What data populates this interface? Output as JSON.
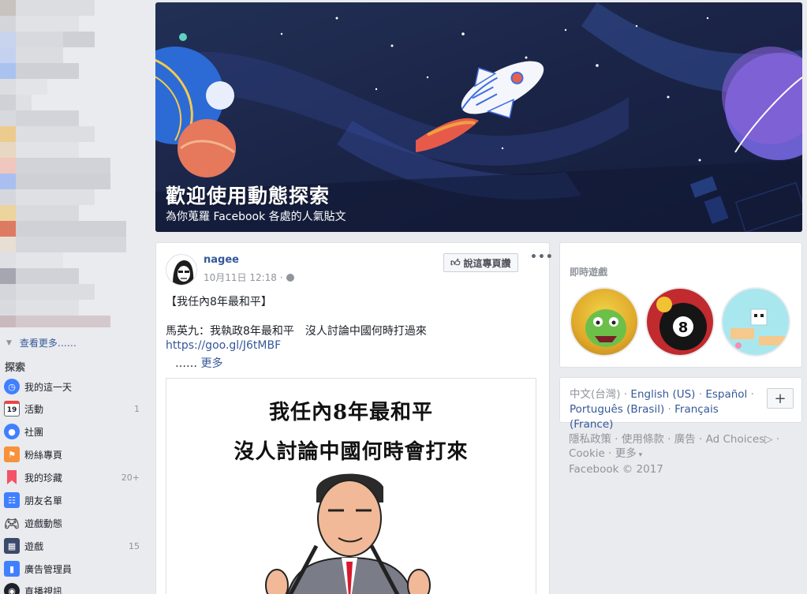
{
  "sidebar": {
    "see_more": "查看更多……",
    "explore_heading": "探索",
    "items": [
      {
        "label": "我的這一天",
        "count": "",
        "icon": "clock-icon",
        "color": "#4080ff"
      },
      {
        "label": "活動",
        "count": "1",
        "icon": "calendar-icon",
        "color": "#ffffff",
        "icon_text": "19"
      },
      {
        "label": "社團",
        "count": "",
        "icon": "groups-icon",
        "color": "#4080ff"
      },
      {
        "label": "粉絲專頁",
        "count": "",
        "icon": "flag-icon",
        "color": "#f7923b"
      },
      {
        "label": "我的珍藏",
        "count": "20+",
        "icon": "bookmark-icon",
        "color": "#f35369"
      },
      {
        "label": "朋友名單",
        "count": "",
        "icon": "friends-list-icon",
        "color": "#4080ff"
      },
      {
        "label": "遊戲動態",
        "count": "",
        "icon": "gamepad-icon",
        "color": "#4b4f56"
      },
      {
        "label": "遊戲",
        "count": "15",
        "icon": "games-icon",
        "color": "#3b4a6b"
      },
      {
        "label": "廣告管理員",
        "count": "",
        "icon": "ads-manager-icon",
        "color": "#4080ff"
      },
      {
        "label": "直播視訊",
        "count": "",
        "icon": "live-video-icon",
        "color": "#1d2129"
      }
    ]
  },
  "banner": {
    "title": "歡迎使用動態探索",
    "subtitle": "為你蒐羅 Facebook 各處的人氣貼文"
  },
  "post": {
    "author": "nagee",
    "date": "10月11日 12:18 ·",
    "like_page_label": "說這專頁讚",
    "line1": "【我任內8年最和平】",
    "line2": "馬英九：我執政8年最和平　沒人討論中國何時打過來",
    "link": "https://goo.gl/J6tMBF",
    "ellipsis": "……",
    "see_more": "更多",
    "image_text_1": "我任內8年最和平",
    "image_text_2": "沒人討論中國何時會打來"
  },
  "games": {
    "title": "即時遊戲"
  },
  "languages": {
    "current": "中文(台灣)",
    "others": [
      "English (US)",
      "Español",
      "Português (Brasil)",
      "Français (France)"
    ],
    "add_label": "+"
  },
  "footer": {
    "links": [
      "隱私政策",
      "使用條款",
      "廣告",
      "Ad Choices",
      "Cookie",
      "更多"
    ],
    "copyright": "Facebook © 2017"
  },
  "colors": {
    "page_bg": "#e9ebee",
    "link": "#365899",
    "banner_bg": "#1b2548"
  }
}
